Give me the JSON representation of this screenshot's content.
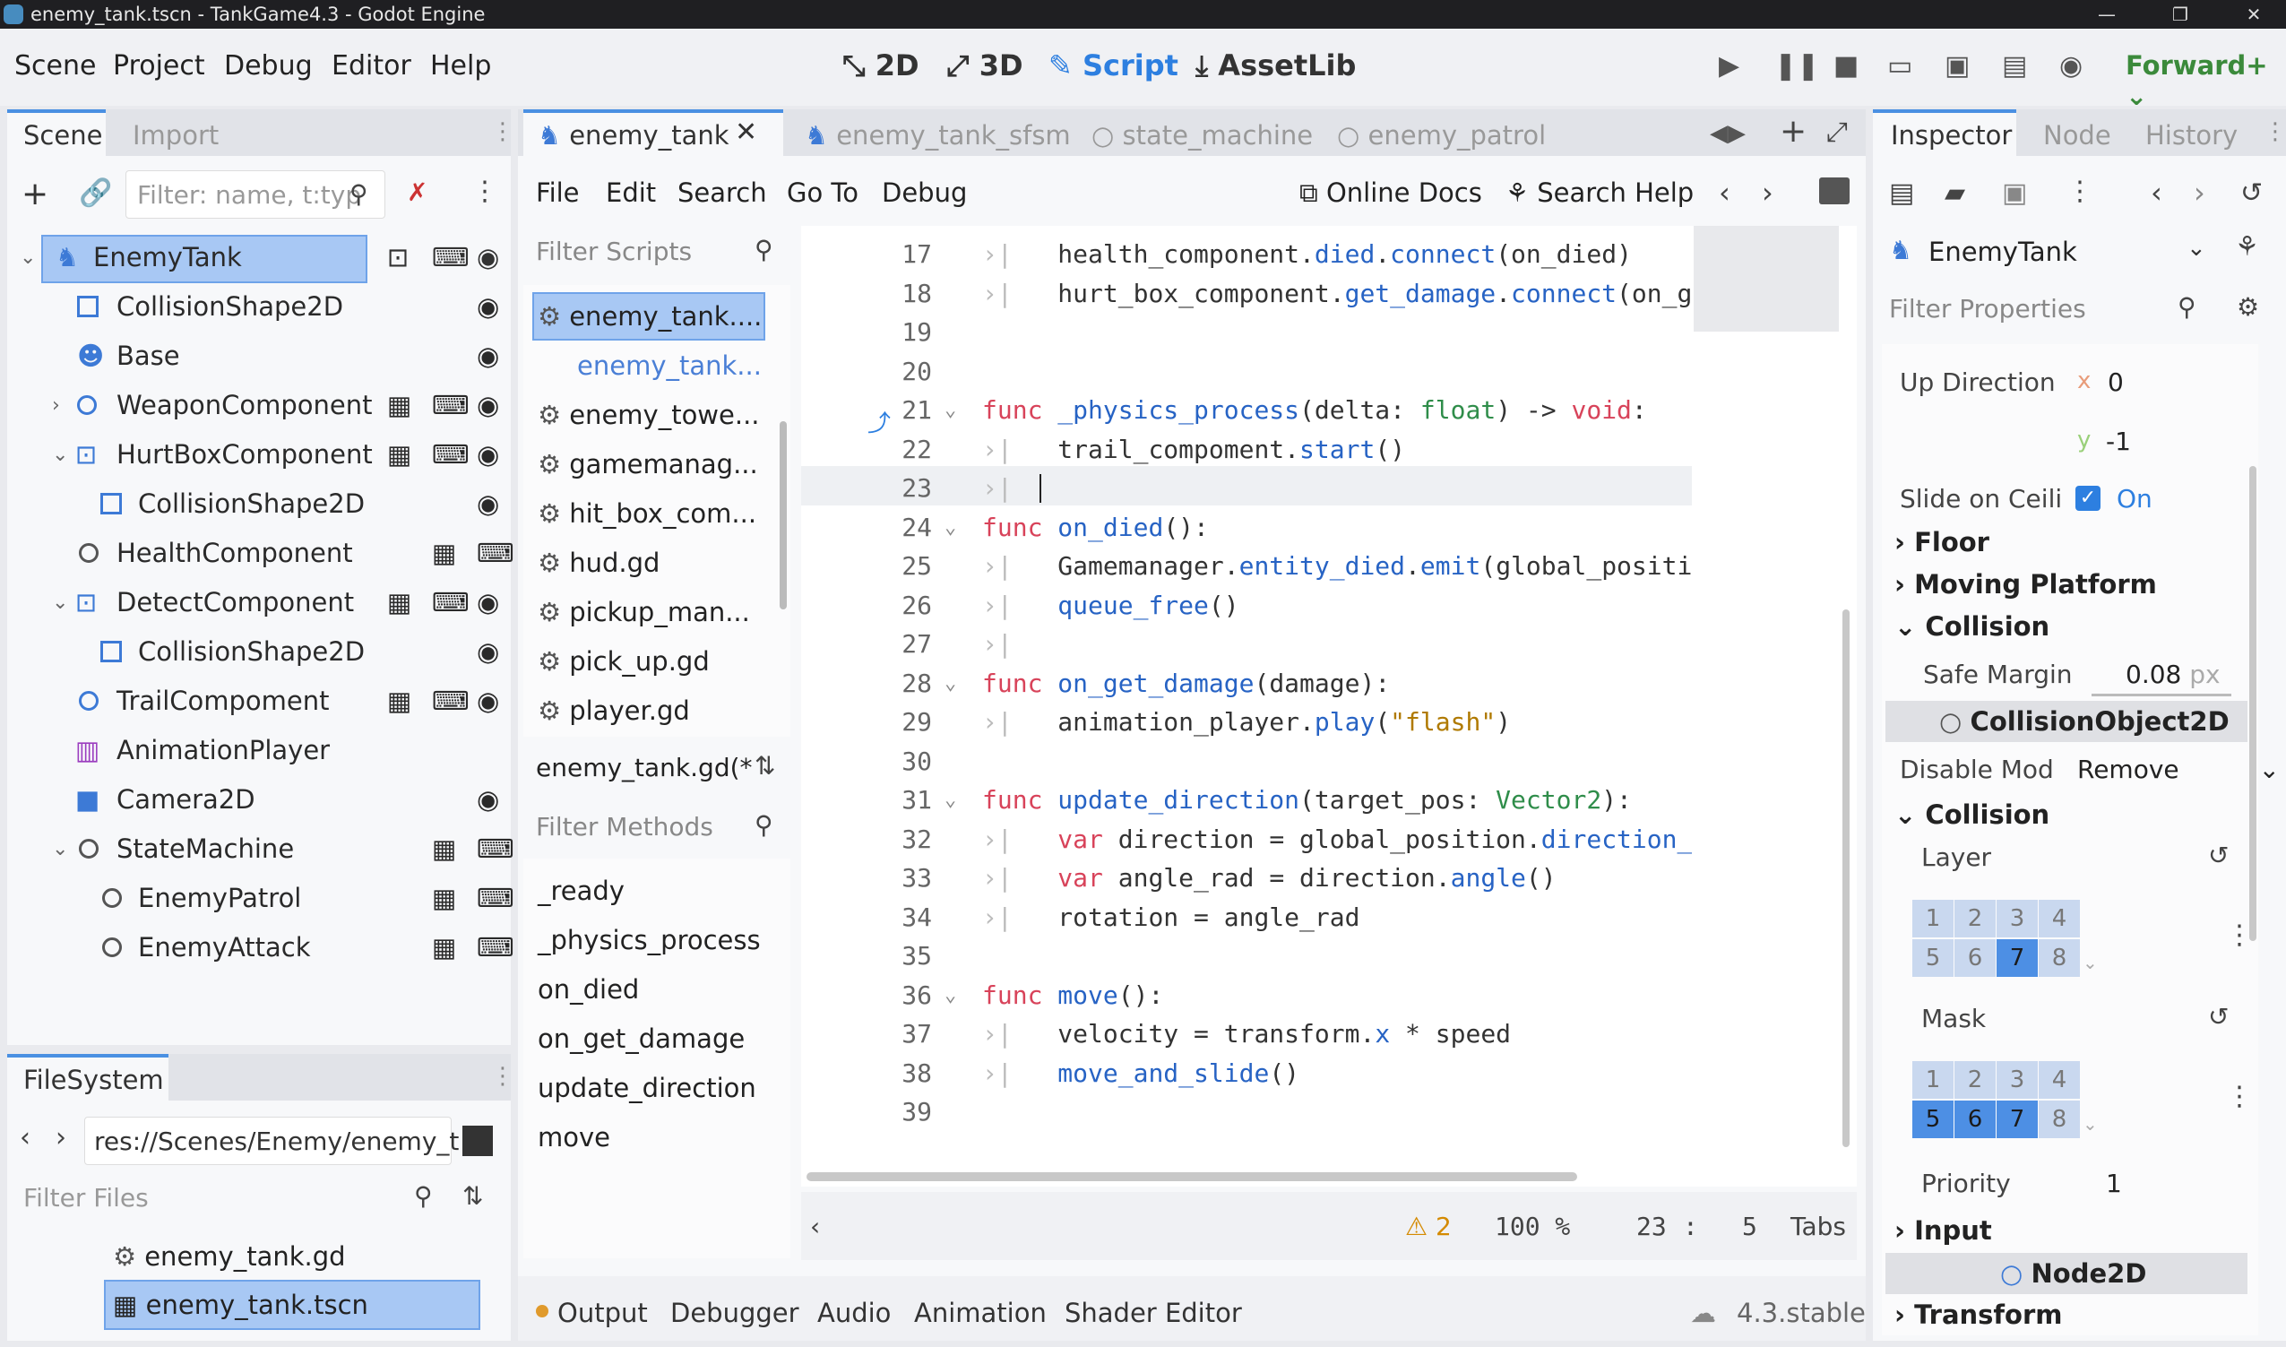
{
  "title": "enemy_tank.tscn - TankGame4.3 - Godot Engine",
  "window_controls": {
    "minimize": "—",
    "maximize": "❐",
    "close": "✕"
  },
  "menu": [
    "Scene",
    "Project",
    "Debug",
    "Editor",
    "Help"
  ],
  "workspaces": [
    "2D",
    "3D",
    "Script",
    "AssetLib"
  ],
  "renderer": "Forward+",
  "scene_dock": {
    "tabs": [
      "Scene",
      "Import"
    ],
    "filter_placeholder": "Filter: name, t:typ",
    "nodes": [
      {
        "label": "EnemyTank",
        "icon": "character-body-icon"
      },
      {
        "label": "CollisionShape2D",
        "icon": "collision-shape-icon"
      },
      {
        "label": "Base",
        "icon": "sprite-icon"
      },
      {
        "label": "WeaponComponent",
        "icon": "node-icon"
      },
      {
        "label": "HurtBoxComponent",
        "icon": "area-icon"
      },
      {
        "label": "CollisionShape2D",
        "icon": "collision-shape-icon"
      },
      {
        "label": "HealthComponent",
        "icon": "node-icon"
      },
      {
        "label": "DetectComponent",
        "icon": "area-icon"
      },
      {
        "label": "CollisionShape2D",
        "icon": "collision-shape-icon"
      },
      {
        "label": "TrailCompoment",
        "icon": "node-icon"
      },
      {
        "label": "AnimationPlayer",
        "icon": "animation-icon"
      },
      {
        "label": "Camera2D",
        "icon": "camera-icon"
      },
      {
        "label": "StateMachine",
        "icon": "node-icon"
      },
      {
        "label": "EnemyPatrol",
        "icon": "node-icon"
      },
      {
        "label": "EnemyAttack",
        "icon": "node-icon"
      }
    ]
  },
  "filesystem": {
    "tab": "FileSystem",
    "path": "res://Scenes/Enemy/enemy_t",
    "filter_placeholder": "Filter Files",
    "files": [
      "enemy_tank.gd",
      "enemy_tank.tscn"
    ]
  },
  "script_tabs": [
    "enemy_tank",
    "enemy_tank_sfsm",
    "state_machine",
    "enemy_patrol"
  ],
  "script_menu": [
    "File",
    "Edit",
    "Search",
    "Go To",
    "Debug"
  ],
  "online_docs": "Online Docs",
  "search_help": "Search Help",
  "filter_scripts": "Filter Scripts",
  "scripts": [
    "enemy_tank....",
    "enemy_tank...",
    "enemy_towe...",
    "gamemanag...",
    "hit_box_com...",
    "hud.gd",
    "pickup_man...",
    "pick_up.gd",
    "player.gd"
  ],
  "current_script": "enemy_tank.gd(*",
  "filter_methods": "Filter Methods",
  "methods": [
    "_ready",
    "_physics_process",
    "on_died",
    "on_get_damage",
    "update_direction",
    "move"
  ],
  "code_lines": [
    {
      "n": "17",
      "t": "    health_component.died.connect(on_died)"
    },
    {
      "n": "18",
      "t": "    hurt_box_component.get_damage.connect(on_ge"
    },
    {
      "n": "19",
      "t": ""
    },
    {
      "n": "20",
      "t": ""
    },
    {
      "n": "21",
      "t": "func _physics_process(delta: float) -> void:"
    },
    {
      "n": "22",
      "t": "    trail_compoment.start()"
    },
    {
      "n": "23",
      "t": "    "
    },
    {
      "n": "24",
      "t": "func on_died():"
    },
    {
      "n": "25",
      "t": "    Gamemanager.entity_died.emit(global_positio"
    },
    {
      "n": "26",
      "t": "    queue_free()"
    },
    {
      "n": "27",
      "t": ""
    },
    {
      "n": "28",
      "t": "func on_get_damage(damage):"
    },
    {
      "n": "29",
      "t": "    animation_player.play(\"flash\")"
    },
    {
      "n": "30",
      "t": ""
    },
    {
      "n": "31",
      "t": "func update_direction(target_pos: Vector2):"
    },
    {
      "n": "32",
      "t": "    var direction = global_position.direction_t"
    },
    {
      "n": "33",
      "t": "    var angle_rad = direction.angle()"
    },
    {
      "n": "34",
      "t": "    rotation = angle_rad"
    },
    {
      "n": "35",
      "t": ""
    },
    {
      "n": "36",
      "t": "func move():"
    },
    {
      "n": "37",
      "t": "    velocity = transform.x * speed"
    },
    {
      "n": "38",
      "t": "    move_and_slide()"
    },
    {
      "n": "39",
      "t": ""
    }
  ],
  "status": {
    "warnings": "2",
    "zoom": "100 %",
    "line": "23",
    "sep": ":",
    "col": "5",
    "indent": "Tabs"
  },
  "bottom_tabs": [
    "Output",
    "Debugger",
    "Audio",
    "Animation",
    "Shader Editor"
  ],
  "version": "4.3.stable",
  "inspector": {
    "tabs": [
      "Inspector",
      "Node",
      "History"
    ],
    "object": "EnemyTank",
    "filter_placeholder": "Filter Properties",
    "up_direction_label": "Up Direction",
    "up_x_label": "x",
    "up_x": "0",
    "up_y_label": "y",
    "up_y": "-1",
    "slide_label": "Slide on Ceili",
    "slide_value": "On",
    "floor": "Floor",
    "moving_platform": "Moving Platform",
    "collision_section": "Collision",
    "safe_margin_label": "Safe Margin",
    "safe_margin": "0.08",
    "safe_margin_unit": "px",
    "collision_object": "CollisionObject2D",
    "disable_mode_label": "Disable Mod",
    "disable_mode": "Remove",
    "collision_sub": "Collision",
    "layer_label": "Layer",
    "layer_bits": [
      "1",
      "2",
      "3",
      "4",
      "5",
      "6",
      "7",
      "8"
    ],
    "layer_on": [
      7
    ],
    "mask_label": "Mask",
    "mask_bits": [
      "1",
      "2",
      "3",
      "4",
      "5",
      "6",
      "7",
      "8"
    ],
    "mask_on": [
      5,
      6,
      7
    ],
    "priority_label": "Priority",
    "priority": "1",
    "input": "Input",
    "node2d": "Node2D",
    "transform": "Transform"
  }
}
